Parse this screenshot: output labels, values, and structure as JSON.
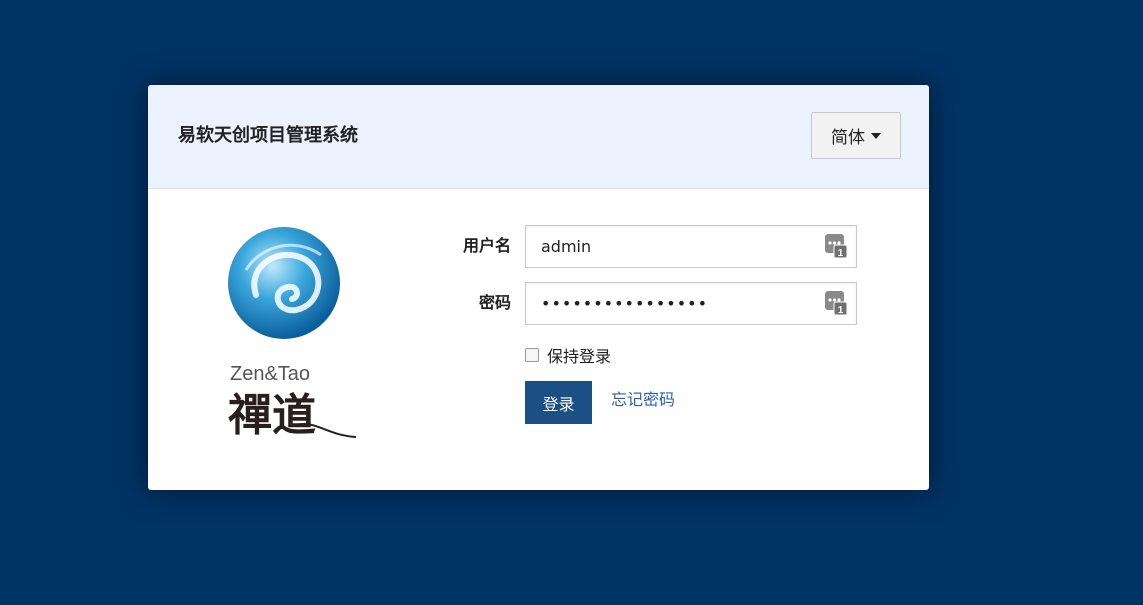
{
  "header": {
    "title": "易软天创项目管理系统",
    "language_label": "简体"
  },
  "logo": {
    "brand_text": "Zen&Tao",
    "brand_chinese": "禪道"
  },
  "form": {
    "username_label": "用户名",
    "username_value": "admin",
    "password_label": "密码",
    "password_value": "••••••••••••••••",
    "remember_label": "保持登录",
    "login_button": "登录",
    "forgot_link": "忘记密码"
  },
  "colors": {
    "background": "#003366",
    "header_bg": "#ebf2fd",
    "primary_button": "#1c4f86",
    "link": "#2a5fb0"
  },
  "icons": {
    "password_manager": "password-manager-icon",
    "dropdown": "caret-down-icon"
  }
}
